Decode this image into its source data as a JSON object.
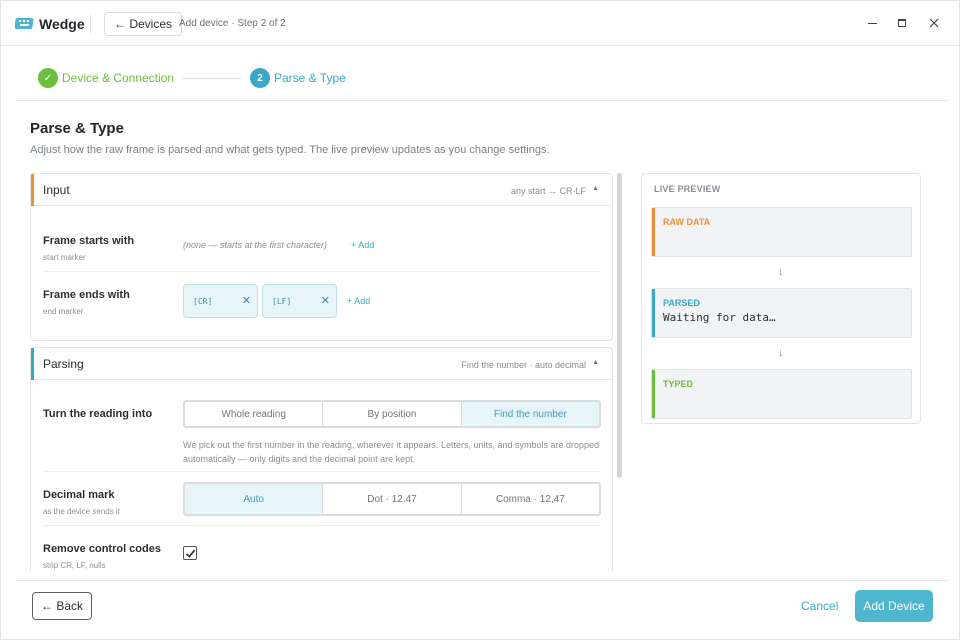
{
  "app": {
    "name": "Wedge",
    "back_label": "← Devices",
    "breadcrumb": "Add device · Step 2 of 2"
  },
  "stepper": {
    "steps": [
      {
        "label": "Device & Connection",
        "badge": "✓"
      },
      {
        "label": "Parse & Type",
        "badge": "2"
      }
    ]
  },
  "page": {
    "title": "Parse & Type",
    "description": "Adjust how the raw frame is parsed and what gets typed. The live preview updates as you change settings."
  },
  "input_section": {
    "title": "Input",
    "summary": "any start → CR·LF",
    "caret": "▲",
    "frame_start": {
      "label": "Frame starts with",
      "sub": "start marker",
      "empty_text": "(none — starts at the first character)",
      "add_label": "+ Add"
    },
    "frame_end": {
      "label": "Frame ends with",
      "sub": "end marker",
      "chips": [
        "[CR]",
        "[LF]"
      ],
      "chip_remove": "✕",
      "add_label": "+ Add"
    }
  },
  "parsing_section": {
    "title": "Parsing",
    "summary": "Find the number · auto decimal",
    "caret": "▲",
    "turn_into": {
      "label": "Turn the reading into",
      "options": [
        "Whole reading",
        "By position",
        "Find the number"
      ],
      "selected": "Find the number",
      "help": "We pick out the first number in the reading, wherever it appears. Letters, units, and symbols are dropped automatically — only digits and the decimal point are kept."
    },
    "decimal": {
      "label": "Decimal mark",
      "sub": "as the device sends it",
      "options": [
        "Auto",
        "Dot · 12.47",
        "Comma · 12,47"
      ],
      "selected": "Auto"
    },
    "control_codes": {
      "label": "Remove control codes",
      "sub": "strip CR, LF, nulls",
      "checked": true
    }
  },
  "preview": {
    "title": "LIVE PREVIEW",
    "arrow": "↓",
    "raw": {
      "label": "RAW DATA",
      "value": "",
      "color": "#e8913a"
    },
    "parsed": {
      "label": "PARSED",
      "value": "Waiting for data…",
      "color": "#3aa9c6"
    },
    "typed": {
      "label": "TYPED",
      "value": "",
      "color": "#6cbf3e"
    }
  },
  "footer": {
    "back_label": "← Back",
    "cancel_label": "Cancel",
    "add_label": "Add Device"
  },
  "colors": {
    "accent": "#3aa9c6",
    "success": "#6cbf3e",
    "input_accent": "#e8913a",
    "primary_button": "#4fb6cf"
  }
}
